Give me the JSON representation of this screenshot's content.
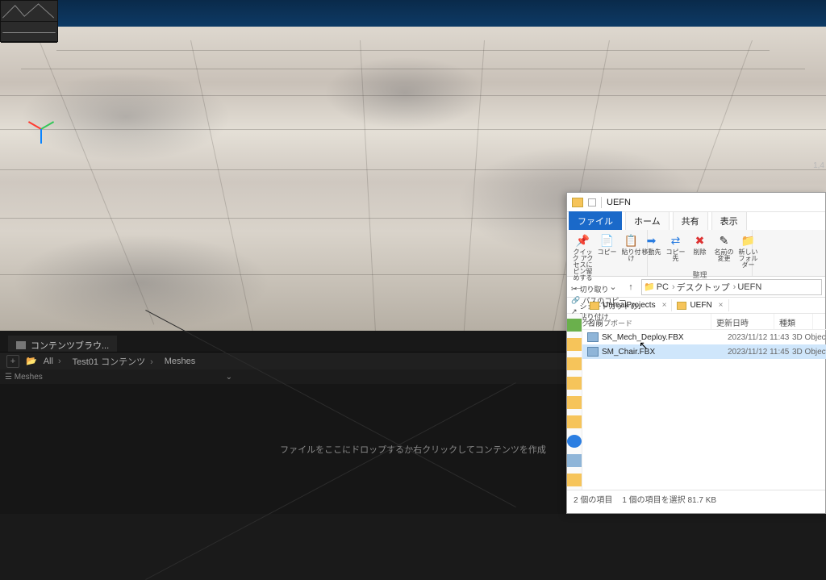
{
  "ue": {
    "stats_value": "1,4",
    "content_browser_tab": "コンテンツブラウ...",
    "breadcrumb": [
      "All",
      "Test01 コンテンツ",
      "Meshes"
    ],
    "subbar_label": "Meshes",
    "drop_hint": "ファイルをここにドロップするか右クリックしてコンテンツを作成"
  },
  "explorer": {
    "title_folder": "UEFN",
    "tabs": {
      "file": "ファイル",
      "home": "ホーム",
      "share": "共有",
      "view": "表示"
    },
    "ribbon": {
      "pin": {
        "label": "クイック アクセスにピン留めする"
      },
      "copy": "コピー",
      "paste": "貼り付け",
      "clipboard_items": [
        "切り取り",
        "パスのコピー",
        "ショートカットの貼り付け"
      ],
      "group_clipboard": "クリップボード",
      "move": "移動先",
      "copyto": "コピー先",
      "delete": "削除",
      "rename": "名前の変更",
      "newfolder": "新しいフォルダー",
      "group_organize": "整理"
    },
    "addr": {
      "segs": [
        "PC",
        "デスクトップ",
        "UEFN"
      ]
    },
    "folder_tabs": [
      {
        "name": "UnrealProjects"
      },
      {
        "name": "UEFN"
      }
    ],
    "columns": {
      "name": "名前",
      "date": "更新日時",
      "type": "種類"
    },
    "files": [
      {
        "name": "SK_Mech_Deploy.FBX",
        "date": "2023/11/12 11:43",
        "type": "3D Object",
        "selected": false
      },
      {
        "name": "SM_Chair.FBX",
        "date": "2023/11/12 11:45",
        "type": "3D Object",
        "selected": true
      }
    ],
    "status": {
      "count": "2 個の項目",
      "selected": "1 個の項目を選択 81.7 KB"
    }
  }
}
